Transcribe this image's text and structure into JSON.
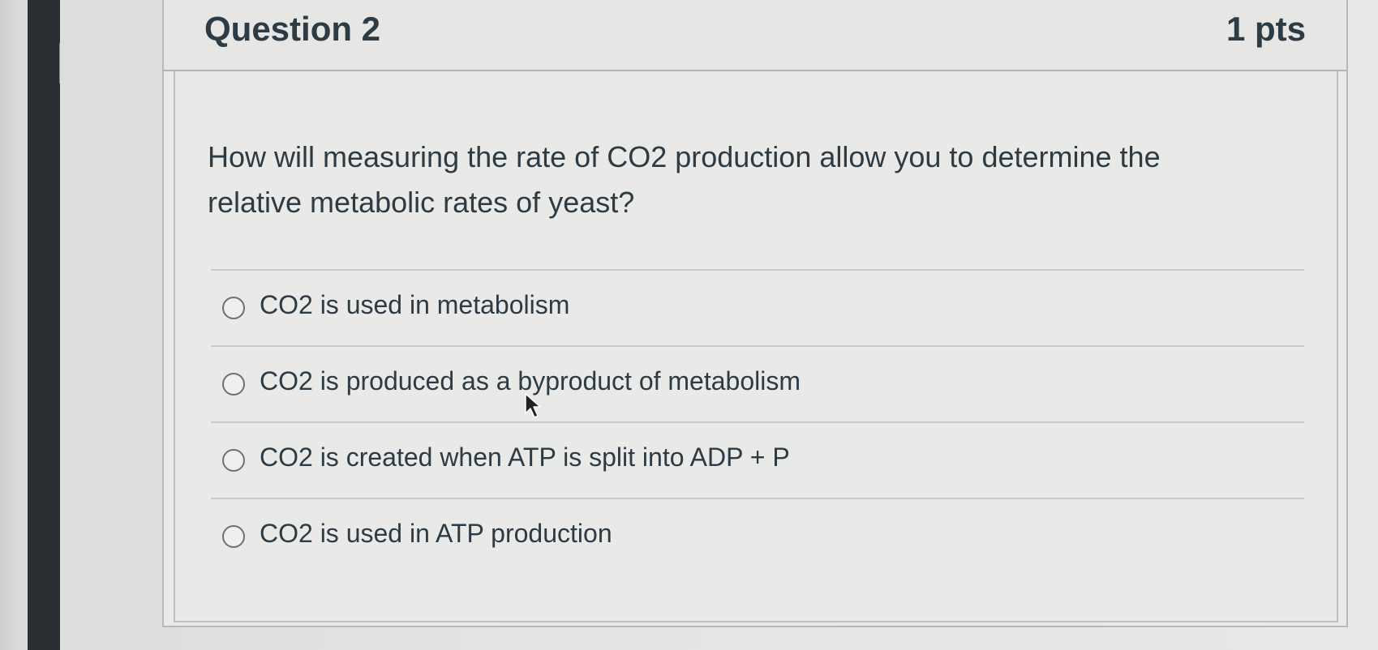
{
  "question": {
    "title": "Question 2",
    "points": "1 pts",
    "text": "How will measuring the rate of CO2 production allow you to determine the relative metabolic rates of yeast?"
  },
  "answers": [
    {
      "label": "CO2 is used in metabolism",
      "selected": false
    },
    {
      "label": "CO2 is produced as a byproduct of metabolism",
      "selected": false
    },
    {
      "label": "CO2 is created when ATP is split into ADP + P",
      "selected": false
    },
    {
      "label": "CO2 is used in ATP production",
      "selected": false
    }
  ],
  "icons": {
    "bookmark": "bookmark-flag-icon",
    "cursor": "mouse-pointer-icon"
  },
  "colors": {
    "text": "#2d3b45",
    "background": "#e9e9e7",
    "rail": "#2b2f33"
  }
}
